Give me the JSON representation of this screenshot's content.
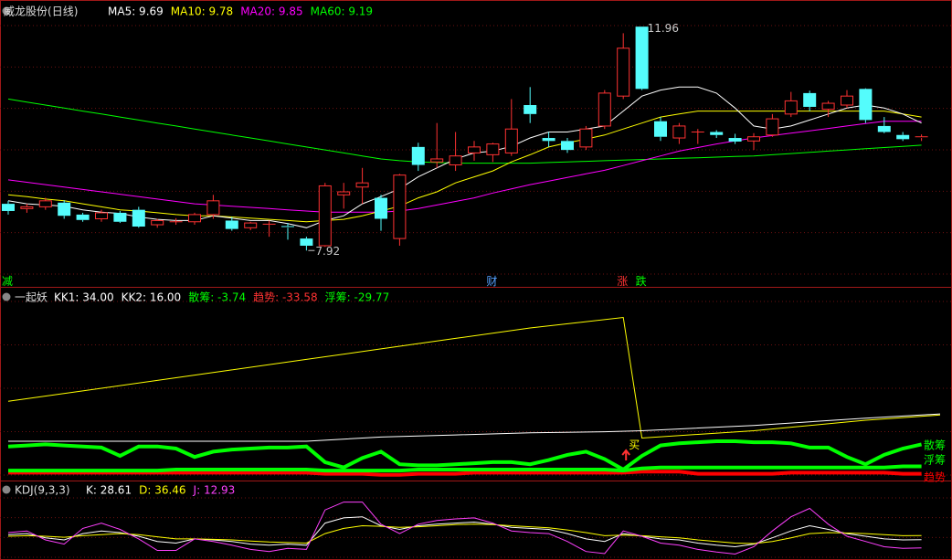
{
  "colors": {
    "up": "#ff3232",
    "down": "#54fcfc",
    "ma5": "#ffffff",
    "ma10": "#ffff00",
    "ma20": "#ff00ff",
    "ma60": "#00ff00",
    "grid": "#6b1010",
    "frame": "#a01818",
    "sanchou": "#00ff00",
    "qushi": "#ff0000",
    "fuchou": "#00ff00"
  },
  "main": {
    "stock": "威龙股份",
    "period": "(日线)",
    "legend": [
      {
        "label": "MA5:",
        "value": "9.69",
        "color": "#ffffff"
      },
      {
        "label": "MA10:",
        "value": "9.78",
        "color": "#ffff00"
      },
      {
        "label": "MA20:",
        "value": "9.85",
        "color": "#ff00ff"
      },
      {
        "label": "MA60:",
        "value": "9.19",
        "color": "#00ff00"
      }
    ],
    "high_label": "11.96",
    "low_label": "7.92",
    "events": [
      {
        "text": "减",
        "color": "#00ff00",
        "i": 0
      },
      {
        "text": "财",
        "color": "#54a0ff",
        "i": 26
      },
      {
        "text": "涨",
        "color": "#ff3232",
        "i": 33
      },
      {
        "text": "跌",
        "color": "#00ff00",
        "i": 34
      }
    ]
  },
  "ind1": {
    "name": "一起妖",
    "legend": [
      {
        "label": "KK1:",
        "value": "34.00",
        "color": "#ffffff"
      },
      {
        "label": "KK2:",
        "value": "16.00",
        "color": "#ffffff"
      },
      {
        "label": "散筹:",
        "value": "-3.74",
        "color": "#00ff00"
      },
      {
        "label": "趋势:",
        "value": "-33.58",
        "color": "#ff3232"
      },
      {
        "label": "浮筹:",
        "value": "-29.77",
        "color": "#00ff00"
      }
    ],
    "buy_label": "买",
    "line_labels": [
      "散筹",
      "浮筹",
      "趋势"
    ]
  },
  "ind2": {
    "name": "KDJ(9,3,3)",
    "legend": [
      {
        "label": "K:",
        "value": "28.61",
        "color": "#ffffff"
      },
      {
        "label": "D:",
        "value": "36.46",
        "color": "#ffff00"
      },
      {
        "label": "J:",
        "value": "12.93",
        "color": "#ff40ff"
      }
    ]
  },
  "chart_data": [
    {
      "type": "candlestick",
      "title": "威龙股份(日线)",
      "ohlc": [
        [
          9.0,
          9.05,
          8.82,
          8.88
        ],
        [
          8.92,
          9.0,
          8.85,
          8.95
        ],
        [
          8.95,
          9.1,
          8.9,
          9.05
        ],
        [
          9.02,
          9.06,
          8.75,
          8.8
        ],
        [
          8.82,
          8.85,
          8.7,
          8.73
        ],
        [
          8.75,
          8.9,
          8.7,
          8.85
        ],
        [
          8.85,
          8.88,
          8.68,
          8.7
        ],
        [
          8.9,
          8.95,
          8.6,
          8.62
        ],
        [
          8.65,
          8.75,
          8.6,
          8.72
        ],
        [
          8.7,
          8.76,
          8.65,
          8.7
        ],
        [
          8.7,
          8.85,
          8.65,
          8.82
        ],
        [
          8.82,
          9.15,
          8.75,
          9.05
        ],
        [
          8.72,
          8.78,
          8.55,
          8.58
        ],
        [
          8.6,
          8.7,
          8.56,
          8.68
        ],
        [
          8.65,
          8.72,
          8.45,
          8.66
        ],
        [
          8.62,
          8.68,
          8.4,
          8.6
        ],
        [
          8.42,
          8.45,
          8.22,
          8.3
        ],
        [
          8.3,
          9.35,
          8.28,
          9.3
        ],
        [
          9.15,
          9.35,
          8.92,
          9.2
        ],
        [
          9.28,
          9.6,
          9.0,
          9.35
        ],
        [
          9.1,
          9.15,
          8.55,
          8.75
        ],
        [
          8.42,
          9.5,
          8.3,
          9.48
        ],
        [
          9.95,
          10.02,
          9.55,
          9.65
        ],
        [
          9.7,
          10.35,
          9.6,
          9.75
        ],
        [
          9.65,
          10.2,
          9.55,
          9.8
        ],
        [
          9.85,
          10.05,
          9.72,
          9.95
        ],
        [
          9.82,
          10.02,
          9.7,
          10.0
        ],
        [
          9.85,
          10.75,
          9.8,
          10.25
        ],
        [
          10.65,
          10.95,
          10.35,
          10.5
        ],
        [
          10.1,
          10.2,
          9.95,
          10.05
        ],
        [
          10.05,
          10.1,
          9.85,
          9.9
        ],
        [
          9.95,
          10.3,
          9.9,
          10.25
        ],
        [
          10.3,
          10.9,
          10.25,
          10.85
        ],
        [
          10.8,
          11.85,
          10.75,
          11.6
        ],
        [
          11.96,
          11.96,
          10.9,
          10.92
        ],
        [
          10.38,
          10.45,
          10.05,
          10.12
        ],
        [
          10.1,
          10.35,
          10.0,
          10.3
        ],
        [
          10.2,
          10.25,
          10.0,
          10.2
        ],
        [
          10.2,
          10.23,
          10.1,
          10.15
        ],
        [
          10.1,
          10.17,
          10.0,
          10.04
        ],
        [
          10.05,
          10.18,
          9.9,
          10.12
        ],
        [
          10.15,
          10.5,
          10.12,
          10.42
        ],
        [
          10.5,
          10.87,
          10.45,
          10.72
        ],
        [
          10.85,
          10.89,
          10.55,
          10.62
        ],
        [
          10.58,
          10.72,
          10.45,
          10.68
        ],
        [
          10.65,
          10.9,
          10.6,
          10.8
        ],
        [
          10.92,
          10.93,
          10.35,
          10.4
        ],
        [
          10.3,
          10.45,
          10.18,
          10.2
        ],
        [
          10.15,
          10.2,
          10.05,
          10.08
        ],
        [
          10.1,
          10.16,
          10.05,
          10.12
        ]
      ],
      "ma5": [
        9.05,
        9.0,
        8.98,
        8.96,
        8.9,
        8.86,
        8.84,
        8.78,
        8.74,
        8.72,
        8.72,
        8.8,
        8.76,
        8.72,
        8.72,
        8.67,
        8.6,
        8.72,
        8.8,
        9.0,
        9.12,
        9.25,
        9.45,
        9.6,
        9.75,
        9.85,
        9.88,
        9.96,
        10.1,
        10.2,
        10.2,
        10.25,
        10.3,
        10.55,
        10.8,
        10.9,
        10.95,
        10.95,
        10.85,
        10.6,
        10.3,
        10.25,
        10.3,
        10.4,
        10.5,
        10.6,
        10.65,
        10.6,
        10.5,
        10.35
      ],
      "ma10": [
        9.15,
        9.12,
        9.08,
        9.05,
        9.0,
        8.95,
        8.9,
        8.88,
        8.85,
        8.82,
        8.8,
        8.8,
        8.78,
        8.76,
        8.74,
        8.72,
        8.7,
        8.72,
        8.74,
        8.8,
        8.88,
        8.96,
        9.1,
        9.2,
        9.35,
        9.45,
        9.55,
        9.7,
        9.82,
        9.95,
        10.02,
        10.08,
        10.15,
        10.25,
        10.35,
        10.45,
        10.5,
        10.55,
        10.55,
        10.55,
        10.55,
        10.55,
        10.55,
        10.55,
        10.55,
        10.55,
        10.55,
        10.55,
        10.5,
        10.45
      ],
      "ma20": [
        9.4,
        9.36,
        9.32,
        9.28,
        9.24,
        9.2,
        9.16,
        9.12,
        9.08,
        9.04,
        9.0,
        8.98,
        8.96,
        8.94,
        8.92,
        8.9,
        8.88,
        8.86,
        8.86,
        8.86,
        8.86,
        8.88,
        8.92,
        8.98,
        9.04,
        9.1,
        9.18,
        9.25,
        9.32,
        9.38,
        9.44,
        9.5,
        9.56,
        9.64,
        9.72,
        9.8,
        9.88,
        9.94,
        10.0,
        10.05,
        10.1,
        10.14,
        10.18,
        10.22,
        10.26,
        10.3,
        10.34,
        10.38,
        10.38,
        10.38
      ],
      "ma60": [
        10.75,
        10.7,
        10.65,
        10.6,
        10.55,
        10.5,
        10.45,
        10.4,
        10.35,
        10.3,
        10.25,
        10.2,
        10.15,
        10.1,
        10.05,
        10.0,
        9.95,
        9.9,
        9.85,
        9.8,
        9.75,
        9.72,
        9.7,
        9.69,
        9.68,
        9.68,
        9.68,
        9.68,
        9.68,
        9.69,
        9.7,
        9.71,
        9.72,
        9.73,
        9.74,
        9.75,
        9.76,
        9.77,
        9.78,
        9.79,
        9.8,
        9.82,
        9.84,
        9.86,
        9.88,
        9.9,
        9.92,
        9.94,
        9.96,
        9.98
      ],
      "ylim": [
        7.75,
        12.1
      ]
    },
    {
      "type": "line",
      "title": "一起妖",
      "series": [
        {
          "name": "KK1",
          "values": [
            [
              0,
              -50
            ],
            [
              4,
              -40
            ],
            [
              8,
              -30
            ],
            [
              12,
              -20
            ],
            [
              16,
              -10
            ],
            [
              20,
              0
            ],
            [
              24,
              10
            ],
            [
              28,
              20
            ],
            [
              33,
              30
            ],
            [
              34,
              -85
            ],
            [
              40,
              -78
            ],
            [
              46,
              -68
            ],
            [
              50,
              -63
            ]
          ]
        },
        {
          "name": "KK2",
          "values": [
            [
              0,
              -88
            ],
            [
              16,
              -88
            ],
            [
              20,
              -84
            ],
            [
              24,
              -82
            ],
            [
              28,
              -80
            ],
            [
              32,
              -79
            ],
            [
              34,
              -78
            ],
            [
              40,
              -73
            ],
            [
              46,
              -66
            ],
            [
              50,
              -62
            ]
          ]
        },
        {
          "name": "散筹",
          "values": [
            -93,
            -92,
            -91,
            -92,
            -93,
            -94,
            -102,
            -93,
            -93,
            -95,
            -103,
            -98,
            -96,
            -95,
            -94,
            -94,
            -93,
            -108,
            -113,
            -104,
            -98,
            -110,
            -111,
            -111,
            -110,
            -109,
            -108,
            -108,
            -110,
            -106,
            -101,
            -98,
            -105,
            -115,
            -102,
            -92,
            -90,
            -89,
            -88,
            -88,
            -89,
            -89,
            -90,
            -94,
            -94,
            -103,
            -110,
            -101,
            -95,
            -91
          ]
        },
        {
          "name": "浮筹",
          "values": [
            -116,
            -116,
            -116,
            -116,
            -116,
            -116,
            -116,
            -116,
            -116,
            -115,
            -115,
            -115,
            -115,
            -115,
            -115,
            -115,
            -115,
            -116,
            -116,
            -116,
            -116,
            -116,
            -115,
            -115,
            -115,
            -115,
            -115,
            -115,
            -115,
            -115,
            -115,
            -115,
            -115,
            -116,
            -114,
            -113,
            -113,
            -113,
            -113,
            -113,
            -113,
            -113,
            -113,
            -113,
            -113,
            -113,
            -113,
            -113,
            -112,
            -112
          ]
        },
        {
          "name": "趋势",
          "values": [
            -118,
            -118,
            -118,
            -118,
            -118,
            -118,
            -118,
            -118,
            -118,
            -118,
            -118,
            -118,
            -118,
            -118,
            -118,
            -118,
            -118,
            -119,
            -119,
            -119,
            -120,
            -120,
            -119,
            -119,
            -119,
            -118,
            -118,
            -118,
            -118,
            -118,
            -118,
            -118,
            -118,
            -118,
            -117,
            -117,
            -117,
            -119,
            -119,
            -119,
            -119,
            -119,
            -118,
            -118,
            -118,
            -118,
            -118,
            -118,
            -119,
            -119
          ]
        }
      ],
      "buy_signal_index": 33,
      "ylim": [
        -122,
        40
      ]
    },
    {
      "type": "line",
      "title": "KDJ(9,3,3)",
      "series": [
        {
          "name": "K",
          "values": [
            38,
            40,
            32,
            28,
            40,
            45,
            42,
            35,
            25,
            22,
            30,
            28,
            25,
            20,
            18,
            20,
            18,
            60,
            70,
            72,
            55,
            48,
            55,
            58,
            60,
            62,
            58,
            52,
            50,
            48,
            40,
            30,
            25,
            40,
            35,
            30,
            28,
            22,
            18,
            15,
            20,
            32,
            45,
            55,
            48,
            40,
            35,
            30,
            28,
            28.61
          ]
        },
        {
          "name": "D",
          "values": [
            35,
            36,
            35,
            33,
            36,
            38,
            40,
            38,
            34,
            30,
            30,
            29,
            28,
            26,
            24,
            23,
            22,
            40,
            50,
            55,
            54,
            52,
            53,
            55,
            57,
            58,
            57,
            55,
            53,
            51,
            47,
            42,
            36,
            37,
            36,
            34,
            32,
            28,
            25,
            22,
            21,
            25,
            32,
            40,
            42,
            41,
            40,
            38,
            36,
            36.46
          ]
        },
        {
          "name": "J",
          "values": [
            42,
            45,
            28,
            20,
            50,
            60,
            48,
            30,
            8,
            8,
            30,
            25,
            18,
            10,
            6,
            12,
            10,
            85,
            100,
            100,
            58,
            40,
            58,
            65,
            68,
            70,
            60,
            45,
            42,
            40,
            25,
            6,
            2,
            45,
            35,
            22,
            18,
            10,
            5,
            1,
            15,
            45,
            72,
            88,
            58,
            35,
            25,
            15,
            12,
            12.93
          ]
        }
      ],
      "ylim": [
        -5,
        108
      ]
    }
  ]
}
